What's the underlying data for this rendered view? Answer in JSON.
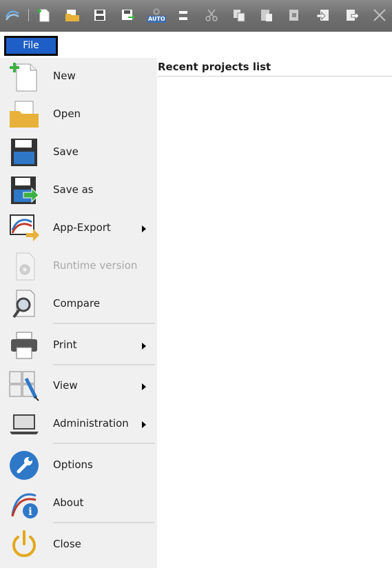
{
  "window": {
    "toolbar_icons": [
      "app-logo-icon",
      "new-document-icon",
      "open-folder-icon",
      "save-icon",
      "save-as-icon",
      "auto-icon",
      "save-all-icon",
      "cut-icon",
      "copy-icon",
      "paste-icon",
      "paste-special-icon",
      "import-icon",
      "export-icon",
      "close-x-icon"
    ],
    "auto_label": "AUTO"
  },
  "file_tab": {
    "label": "File",
    "color": "#1d5ec7"
  },
  "menu": {
    "items": [
      {
        "label": "New",
        "icon": "new-document-icon"
      },
      {
        "label": "Open",
        "icon": "open-folder-icon"
      },
      {
        "label": "Save",
        "icon": "save-icon"
      },
      {
        "label": "Save as",
        "icon": "save-as-icon"
      },
      {
        "label": "App-Export",
        "icon": "app-export-icon",
        "submenu": true
      },
      {
        "label": "Runtime version",
        "icon": "runtime-gear-icon",
        "disabled": true
      },
      {
        "label": "Compare",
        "icon": "compare-magnifier-icon"
      },
      {
        "label": "Print",
        "icon": "printer-icon",
        "submenu": true
      },
      {
        "label": "View",
        "icon": "view-layout-icon",
        "submenu": true
      },
      {
        "label": "Administration",
        "icon": "laptop-icon",
        "submenu": true
      },
      {
        "label": "Options",
        "icon": "wrench-icon"
      },
      {
        "label": "About",
        "icon": "about-info-icon"
      },
      {
        "label": "Close",
        "icon": "power-icon"
      }
    ]
  },
  "recent": {
    "title": "Recent projects list"
  },
  "colors": {
    "accent": "#1d5ec7",
    "folder": "#e8b13a",
    "save_blue": "#2f78c8",
    "green": "#3cb043",
    "power": "#e3a81c"
  }
}
